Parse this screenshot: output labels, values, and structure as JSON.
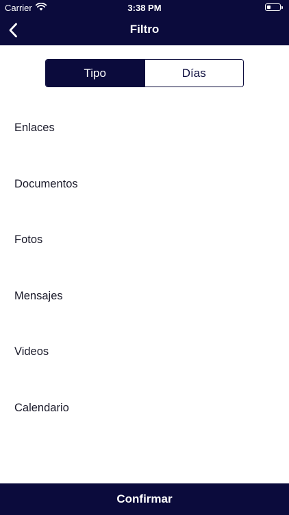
{
  "status_bar": {
    "carrier": "Carrier",
    "time": "3:38 PM",
    "battery_level": 0.3
  },
  "navbar": {
    "title": "Filtro",
    "back_icon": "chevron-left-icon"
  },
  "segmented_control": {
    "selected": "Tipo",
    "segments": [
      "Tipo",
      "Días"
    ]
  },
  "filter_types": [
    "Enlaces",
    "Documentos",
    "Fotos",
    "Mensajes",
    "Videos",
    "Calendario"
  ],
  "footer": {
    "confirm_label": "Confirmar"
  },
  "colors": {
    "primary": "#0b0b3c",
    "background": "#ffffff",
    "text": "#1a1a2a"
  }
}
